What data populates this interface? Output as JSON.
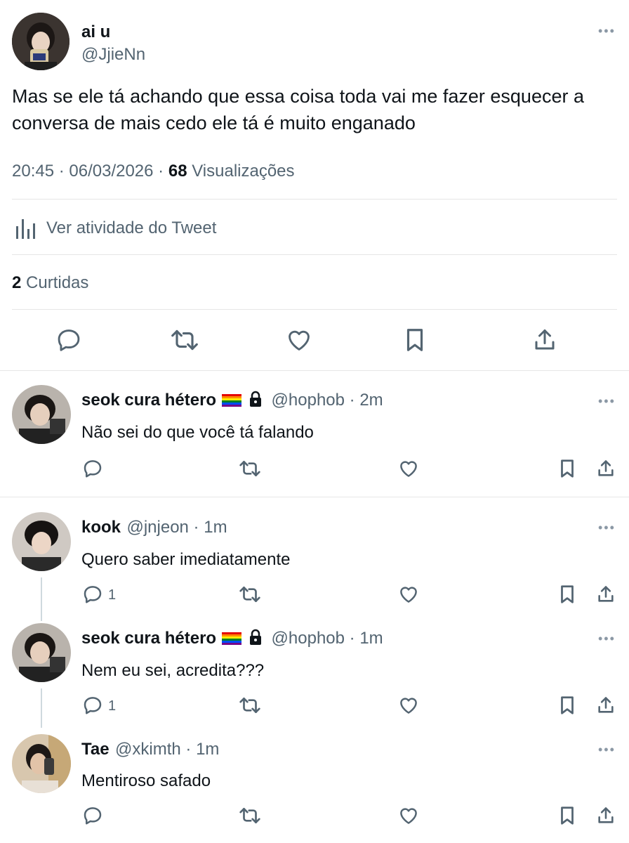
{
  "main_tweet": {
    "display_name": "ai u",
    "handle": "@JjieNn",
    "text": "Mas se ele tá achando que essa coisa toda vai me fazer esquecer a conversa de mais cedo ele tá é muito enganado",
    "time": "20:45 · 06/03/2026 · ",
    "views_count": "68",
    "views_label": "Visualizações",
    "activity_label": "Ver atividade do Tweet",
    "likes_count": "2",
    "likes_label": "Curtidas"
  },
  "replies": [
    {
      "display_name": "seok cura hétero",
      "handle": "@hophob · 2m",
      "text": "Não sei do que você tá falando",
      "reply_count": ""
    },
    {
      "display_name": "kook",
      "handle": "@jnjeon · 1m",
      "text": "Quero saber imediatamente",
      "reply_count": "1"
    },
    {
      "display_name": "seok cura hétero",
      "handle": "@hophob · 1m",
      "text": "Nem eu sei, acredita???",
      "reply_count": "1"
    },
    {
      "display_name": "Tae",
      "handle": "@xkimth · 1m",
      "text": "Mentiroso safado",
      "reply_count": ""
    }
  ],
  "icons": {
    "reply": "reply-icon",
    "retweet": "retweet-icon",
    "like": "heart-icon",
    "bookmark": "bookmark-icon",
    "share": "share-icon",
    "more": "more-icon",
    "analytics": "analytics-icon",
    "lock": "lock-icon",
    "flag": "rainbow-flag-icon"
  },
  "colors": {
    "text": "#0f1419",
    "muted": "#536471",
    "divider": "#e6e6e6"
  }
}
